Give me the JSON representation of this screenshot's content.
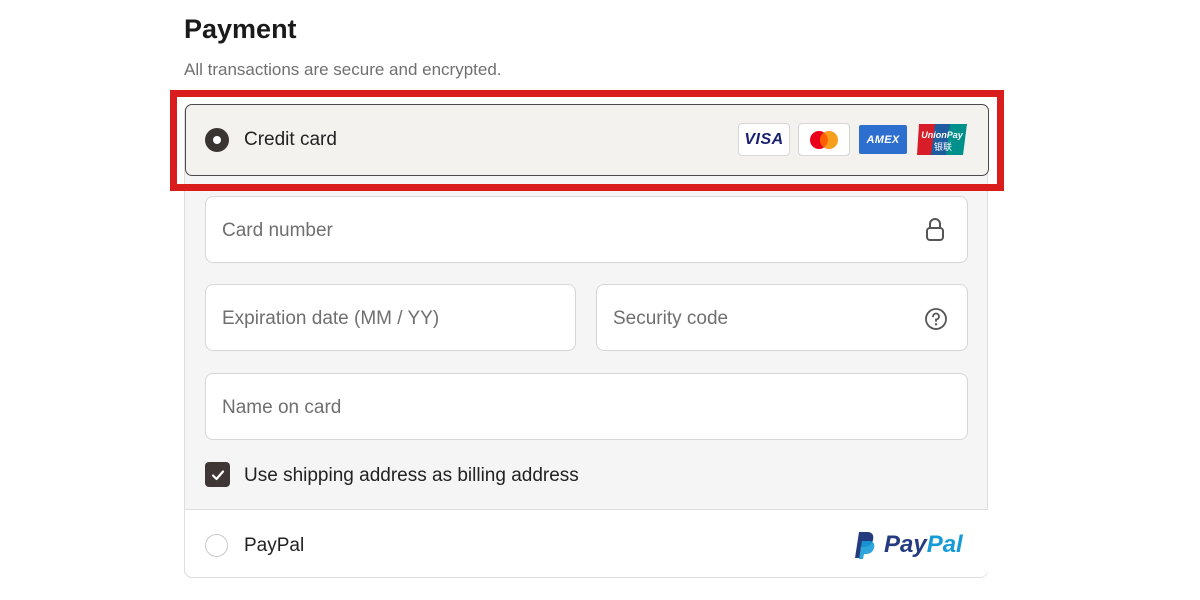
{
  "header": {
    "title": "Payment",
    "subtitle": "All transactions are secure and encrypted."
  },
  "options": {
    "credit_card": {
      "label": "Credit card",
      "selected": true,
      "card_brands": [
        "VISA",
        "Mastercard",
        "AMEX",
        "UnionPay"
      ],
      "visa_label": "VISA",
      "amex_label": "AMEX",
      "unionpay_label": "UnionPay",
      "unionpay_cn": "银联"
    },
    "paypal": {
      "label": "PayPal",
      "selected": false,
      "logo_text_pay": "Pay",
      "logo_text_pal": "Pal"
    }
  },
  "form": {
    "card_number": {
      "placeholder": "Card number",
      "value": "",
      "icon": "lock-icon"
    },
    "expiration": {
      "placeholder": "Expiration date (MM / YY)",
      "value": ""
    },
    "security_code": {
      "placeholder": "Security code",
      "value": "",
      "icon": "help-circle-icon"
    },
    "name_on_card": {
      "placeholder": "Name on card",
      "value": ""
    },
    "billing_checkbox": {
      "label": "Use shipping address as billing address",
      "checked": true
    }
  },
  "colors": {
    "highlight": "#d91c1c",
    "radio_selected": "#3a3533",
    "paypal_dark": "#253b80",
    "paypal_light": "#179bd7"
  }
}
